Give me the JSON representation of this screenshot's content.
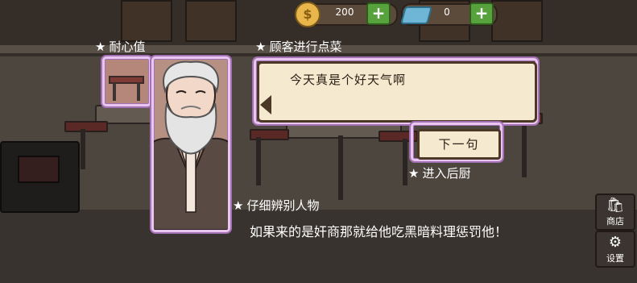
{
  "hud": {
    "coins": "200",
    "gems": "0",
    "coin_icon": "coin-icon",
    "gem_icon": "gem-icon",
    "plus": "+"
  },
  "tutorial": {
    "patience_label": "耐心值",
    "order_label": "顾客进行点菜",
    "kitchen_label": "进入后厨",
    "identify_label": "仔细辨别人物",
    "hint": "如果来的是奸商那就给他吃黑暗料理惩罚他！",
    "star": "★"
  },
  "dialog": {
    "text": "今天真是个好天气啊",
    "next_button": "下一句"
  },
  "sidebar": {
    "shop_label": "商店",
    "settings_label": "设置",
    "shop_icon": "bag-icon",
    "settings_icon": "gear-icon"
  },
  "colors": {
    "highlight": "#e9c6f0",
    "bubble_bg": "#f5e9cf",
    "plus_green": "#57a23c"
  }
}
